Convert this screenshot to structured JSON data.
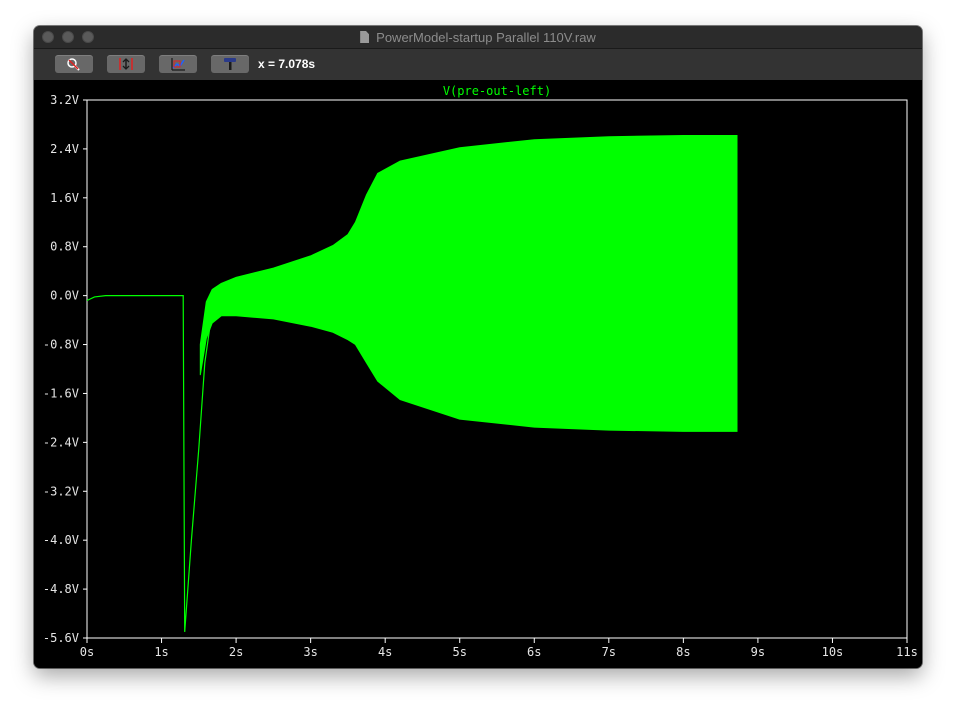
{
  "window": {
    "title": "PowerModel-startup Parallel 110V.raw"
  },
  "toolbar": {
    "buttons": [
      {
        "name": "zoom-button",
        "icon": "zoom-icon"
      },
      {
        "name": "autoscale-button",
        "icon": "autoscale-icon"
      },
      {
        "name": "pan-button",
        "icon": "pan-icon"
      },
      {
        "name": "hammer-button",
        "icon": "hammer-icon"
      }
    ],
    "cursor_readout": "x = 7.078s"
  },
  "colors": {
    "trace": "#00ff00",
    "axes": "#ffffff",
    "background": "#000000",
    "tick_text": "#e6e6e6"
  },
  "chart_data": {
    "type": "line",
    "title": "V(pre-out-left)",
    "xlabel": "",
    "ylabel": "",
    "xlim": [
      0,
      11
    ],
    "ylim": [
      -5.6,
      3.2
    ],
    "x_ticks": [
      0,
      1,
      2,
      3,
      4,
      5,
      6,
      7,
      8,
      9,
      10,
      11
    ],
    "x_tick_labels": [
      "0s",
      "1s",
      "2s",
      "3s",
      "4s",
      "5s",
      "6s",
      "7s",
      "8s",
      "9s",
      "10s",
      "11s"
    ],
    "y_ticks": [
      3.2,
      2.4,
      1.6,
      0.8,
      0.0,
      -0.8,
      -1.6,
      -2.4,
      -3.2,
      -4.0,
      -4.8,
      -5.6
    ],
    "y_tick_labels": [
      "3.2V",
      "2.4V",
      "1.6V",
      "0.8V",
      "0.0V",
      "-0.8V",
      "-1.6V",
      "-2.4V",
      "-3.2V",
      "-4.0V",
      "-4.8V",
      "-5.6V"
    ],
    "grid": false,
    "series": [
      {
        "name": "V(pre-out-left)",
        "line": [
          [
            0,
            -0.08
          ],
          [
            0.1,
            -0.02
          ],
          [
            0.25,
            0.0
          ],
          [
            1.29,
            0.0
          ],
          [
            1.31,
            -5.5
          ],
          [
            1.4,
            -4.0
          ],
          [
            1.5,
            -2.5
          ],
          [
            1.58,
            -1.1
          ],
          [
            1.65,
            -0.5
          ]
        ],
        "upper_envelope": [
          [
            1.52,
            -0.8
          ],
          [
            1.6,
            -0.1
          ],
          [
            1.68,
            0.1
          ],
          [
            1.8,
            0.2
          ],
          [
            2.0,
            0.3
          ],
          [
            2.5,
            0.45
          ],
          [
            3.0,
            0.65
          ],
          [
            3.3,
            0.82
          ],
          [
            3.5,
            1.0
          ],
          [
            3.6,
            1.2
          ],
          [
            3.75,
            1.65
          ],
          [
            3.9,
            2.0
          ],
          [
            4.2,
            2.2
          ],
          [
            5.0,
            2.42
          ],
          [
            6.0,
            2.55
          ],
          [
            7.0,
            2.6
          ],
          [
            8.0,
            2.62
          ],
          [
            8.72,
            2.62
          ]
        ],
        "lower_envelope": [
          [
            1.52,
            -1.3
          ],
          [
            1.6,
            -0.7
          ],
          [
            1.68,
            -0.45
          ],
          [
            1.8,
            -0.33
          ],
          [
            2.0,
            -0.33
          ],
          [
            2.5,
            -0.38
          ],
          [
            3.0,
            -0.5
          ],
          [
            3.3,
            -0.6
          ],
          [
            3.5,
            -0.72
          ],
          [
            3.6,
            -0.8
          ],
          [
            3.75,
            -1.1
          ],
          [
            3.9,
            -1.4
          ],
          [
            4.2,
            -1.7
          ],
          [
            5.0,
            -2.02
          ],
          [
            6.0,
            -2.15
          ],
          [
            7.0,
            -2.2
          ],
          [
            8.0,
            -2.22
          ],
          [
            8.72,
            -2.22
          ]
        ]
      }
    ]
  }
}
